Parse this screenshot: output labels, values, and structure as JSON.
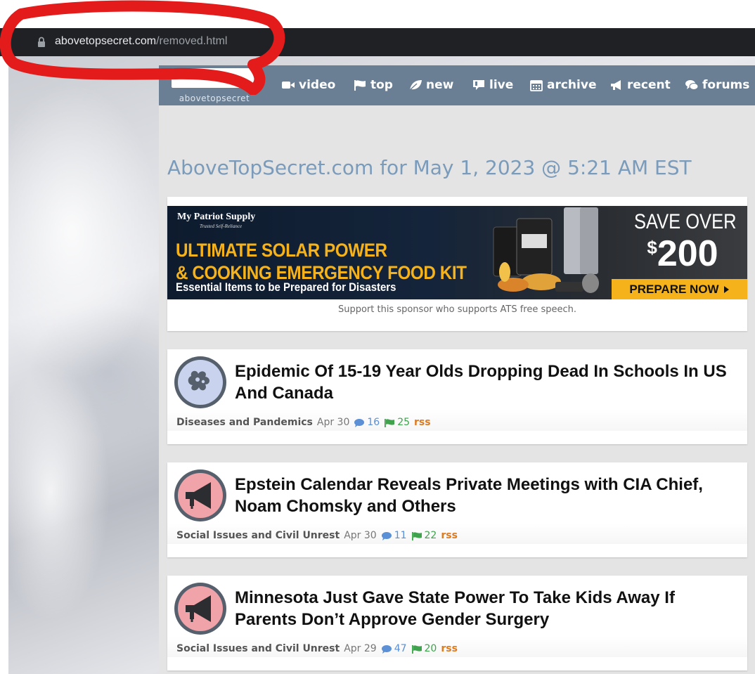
{
  "browser": {
    "url_domain": "abovetopsecret.com",
    "url_path": "/removed.html"
  },
  "site": {
    "logo_text": "abovetopsecret",
    "nav": [
      {
        "label": "video",
        "icon": "video-camera-icon"
      },
      {
        "label": "top",
        "icon": "flag-icon"
      },
      {
        "label": "new",
        "icon": "leaf-icon"
      },
      {
        "label": "live",
        "icon": "live-icon"
      },
      {
        "label": "archive",
        "icon": "calendar-icon"
      },
      {
        "label": "recent",
        "icon": "megaphone-icon"
      },
      {
        "label": "forums",
        "icon": "chat-bubbles-icon"
      }
    ],
    "nav_color": "#6a7f94"
  },
  "page": {
    "date_title": "AboveTopSecret.com for May 1, 2023 @ 5:21 AM EST"
  },
  "ad": {
    "brand": "My Patriot Supply",
    "brand_tagline": "Trusted Self-Reliance",
    "headline_1": "ULTIMATE SOLAR POWER",
    "headline_2": "& COOKING EMERGENCY FOOD KIT",
    "subline": "Essential Items to be Prepared for Disasters",
    "save_text": "SAVE OVER",
    "save_amount_symbol": "$",
    "save_amount": "200",
    "cta": "PREPARE NOW",
    "caption": "Support this sponsor who supports ATS free speech.",
    "accent_color": "#f5b21a"
  },
  "threads": [
    {
      "title": "Epidemic Of 15-19 Year Olds Dropping Dead In Schools In US And Canada",
      "forum": "Diseases and Pandemics",
      "date": "Apr 30",
      "replies": "16",
      "flags": "25",
      "rss": "rss",
      "icon": "virus-icon"
    },
    {
      "title": "Epstein Calendar Reveals Private Meetings with CIA Chief, Noam Chomsky and Others",
      "forum": "Social Issues and Civil Unrest",
      "date": "Apr 30",
      "replies": "11",
      "flags": "22",
      "rss": "rss",
      "icon": "megaphone-icon"
    },
    {
      "title": "Minnesota Just Gave State Power To Take Kids Away If Parents Don’t Approve Gender Surgery",
      "forum": "Social Issues and Civil Unrest",
      "date": "Apr 29",
      "replies": "47",
      "flags": "20",
      "rss": "rss",
      "icon": "megaphone-icon"
    }
  ],
  "annotation": {
    "color": "#e31b1b"
  }
}
